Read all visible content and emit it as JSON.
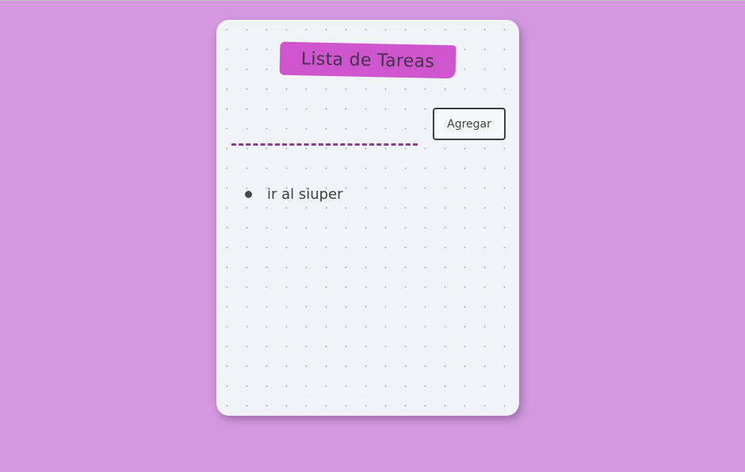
{
  "app": {
    "title": "Lista de Tareas"
  },
  "form": {
    "input_value": "",
    "input_placeholder": "",
    "add_label": "Agregar"
  },
  "tasks": [
    {
      "text": "ir al siuper"
    }
  ],
  "colors": {
    "page_background": "#d398df",
    "card_background": "#f1f4f6",
    "title_highlight": "#cf55cf",
    "input_underline": "#8a3f8f",
    "text": "#404040"
  }
}
